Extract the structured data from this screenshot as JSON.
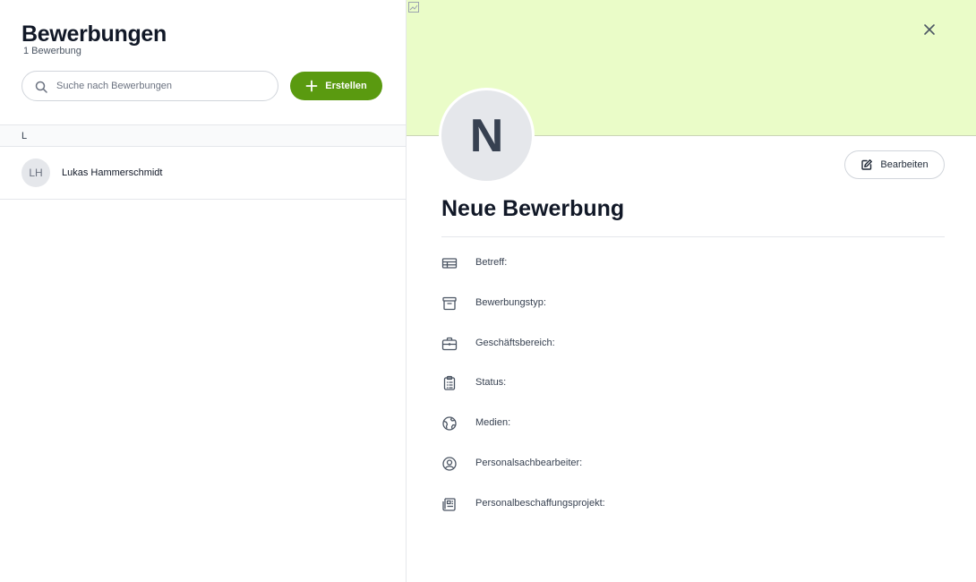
{
  "list": {
    "title": "Bewerbungen",
    "count": "1 Bewerbung",
    "search_placeholder": "Suche nach Bewerbungen",
    "create_label": "Erstellen",
    "groups": [
      {
        "letter": "L",
        "items": [
          {
            "initials": "LH",
            "name": "Lukas Hammerschmidt"
          }
        ]
      }
    ]
  },
  "detail": {
    "avatar_letter": "N",
    "edit_label": "Bearbeiten",
    "title": "Neue Bewerbung",
    "fields": [
      {
        "icon": "table-icon",
        "label": "Betreff:"
      },
      {
        "icon": "archive-icon",
        "label": "Bewerbungstyp:"
      },
      {
        "icon": "briefcase-icon",
        "label": "Geschäftsbereich:"
      },
      {
        "icon": "clipboard-list-icon",
        "label": "Status:"
      },
      {
        "icon": "globe-icon",
        "label": "Medien:"
      },
      {
        "icon": "user-circle-icon",
        "label": "Personalsachbearbeiter:"
      },
      {
        "icon": "newspaper-icon",
        "label": "Personalbeschaffungsprojekt:"
      }
    ]
  },
  "colors": {
    "accent": "#5a9a10",
    "banner": "#eafcc8"
  }
}
